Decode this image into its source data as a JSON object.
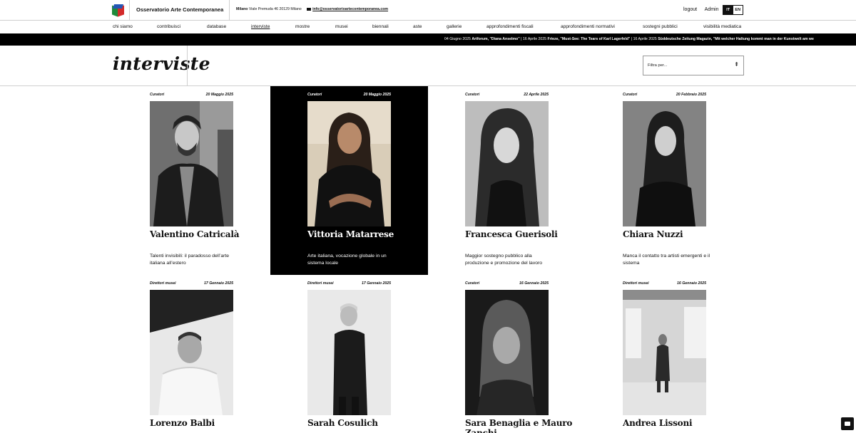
{
  "site": {
    "name": "Osservatorio Arte Contemporanea",
    "city": "Milano",
    "address": "Viale Premuda 46 20129 Milano",
    "email": "info@osservatorioartecontemporanea.com"
  },
  "user_links": {
    "logout": "logout",
    "admin": "Admin"
  },
  "lang": {
    "it": "IT",
    "en": "EN"
  },
  "nav": [
    "chi siamo",
    "contribuisci",
    "database",
    "interviste",
    "mostre",
    "musei",
    "biennali",
    "aste",
    "gallerie",
    "approfondimenti fiscali",
    "approfondimenti normativi",
    "sostegni pubblici",
    "visibilità mediatica"
  ],
  "ticker": {
    "item1_date": "04 Giugno 2025",
    "item1_source": "Artforum, \"Diana Anselmo\"",
    "item2_date": "| 16 Aprile 2025",
    "item2_source": "Frieze, \"Must-See: The Tears of Karl Lagerfeld\"",
    "item3_date": "| 16 Aprile 2025",
    "item3_source": "Süddeutsche Zeitung Magazin, \"Mit welcher Haltung kommt man in der Kunstwelt am we"
  },
  "page": {
    "title": "interviste",
    "filter_placeholder": "Filtra per..."
  },
  "cards": [
    {
      "category": "Curatori",
      "date": "20 Maggio 2025",
      "name": "Valentino Catricalà",
      "desc": "Talenti invisibili: il paradosso dell’arte italiana all’estero"
    },
    {
      "category": "Curatori",
      "date": "20 Maggio 2025",
      "name": "Vittoria Matarrese",
      "desc": "Arte italiana, vocazione globale in un sistema locale"
    },
    {
      "category": "Curatori",
      "date": "22 Aprile 2025",
      "name": "Francesca Guerisoli",
      "desc": "Maggior sostegno pubblico alla produzione e promozione del lavoro"
    },
    {
      "category": "Curatori",
      "date": "20 Febbraio 2025",
      "name": "Chiara Nuzzi",
      "desc": "Manca il contatto tra artisti emergenti e il sistema"
    },
    {
      "category": "Direttori musei",
      "date": "17 Gennaio 2025",
      "name": "Lorenzo Balbi",
      "desc": ""
    },
    {
      "category": "Direttori musei",
      "date": "17 Gennaio 2025",
      "name": "Sarah Cosulich",
      "desc": ""
    },
    {
      "category": "Curatori",
      "date": "16 Gennaio 2025",
      "name": "Sara Benaglia e Mauro Zanchi",
      "desc": ""
    },
    {
      "category": "Direttori musei",
      "date": "16 Gennaio 2025",
      "name": "Andrea Lissoni",
      "desc": ""
    }
  ]
}
